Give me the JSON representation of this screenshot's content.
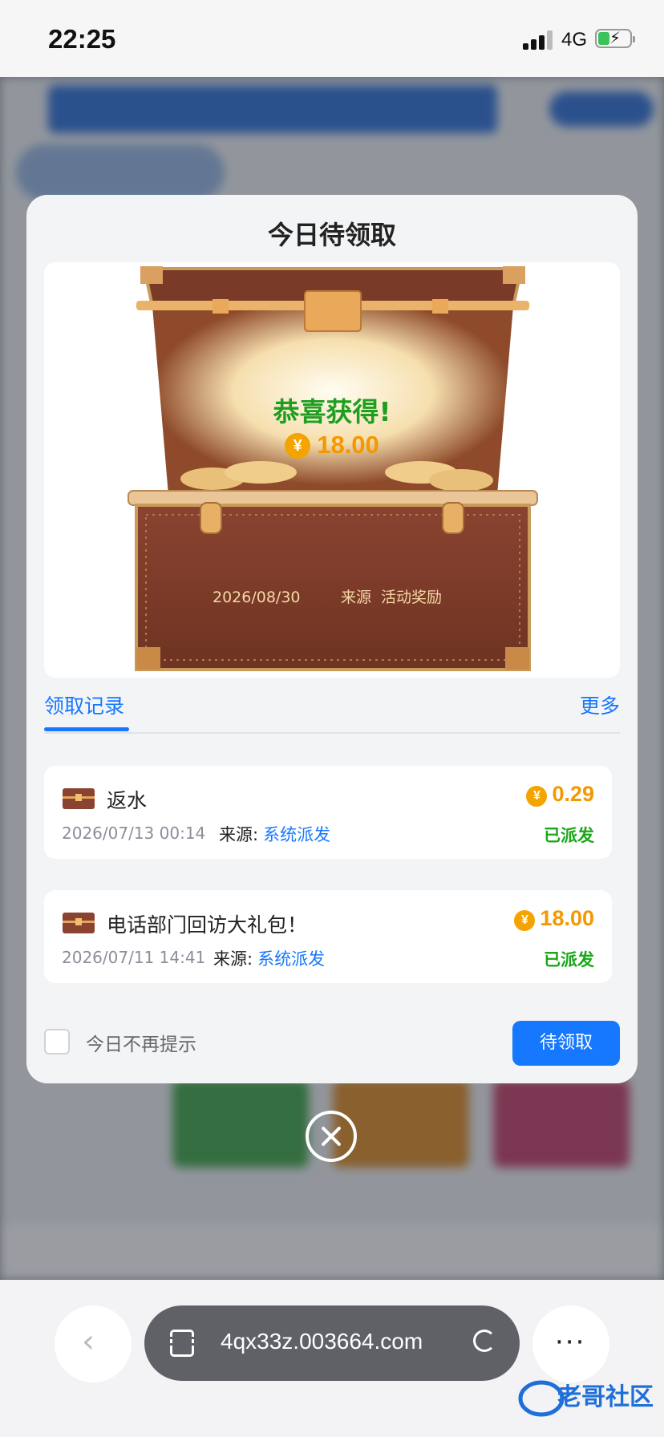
{
  "status_bar": {
    "time": "22:25",
    "network": "4G"
  },
  "modal": {
    "title": "今日待领取",
    "chest": {
      "congrats": "恭喜获得!",
      "currency_symbol": "¥",
      "amount": "18.00",
      "date": "2026/08/30",
      "source_label": "来源",
      "source_value": "活动奖励"
    },
    "tabs": {
      "active": "领取记录",
      "more": "更多"
    },
    "records": [
      {
        "title": "返水",
        "amount": "0.29",
        "date": "2026/07/13 00:14",
        "source_label": "来源:",
        "source_value": "系统派发",
        "status": "已派发"
      },
      {
        "title": "电话部门回访大礼包！",
        "amount": "18.00",
        "date": "2026/07/11 14:41",
        "source_label": "来源:",
        "source_value": "系统派发",
        "status": "已派发"
      }
    ],
    "dont_show_today": "今日不再提示",
    "claim_button": "待领取"
  },
  "browser": {
    "url": "4qx33z.003664.com",
    "more": "···",
    "back": "‹"
  },
  "watermark": "老哥社区",
  "colors": {
    "accent": "#1677ff",
    "amount": "#f39800",
    "success": "#19a819",
    "congrats": "#1f9e1f"
  },
  "icons": [
    "signal-icon",
    "battery-charging-icon",
    "coin-icon",
    "treasure-chest-icon",
    "close-circle-icon",
    "back-chevron-icon",
    "tabs-icon",
    "reload-icon",
    "more-icon"
  ]
}
